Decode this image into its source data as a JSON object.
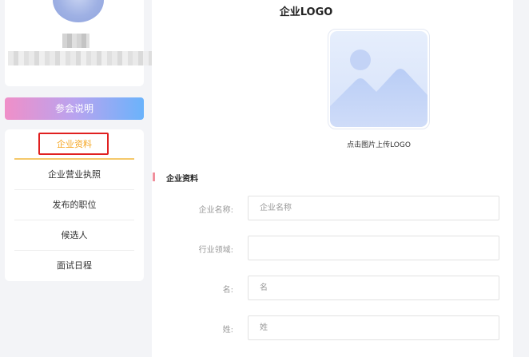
{
  "sidebar": {
    "join_button_label": "参会说明",
    "menu": [
      {
        "label": "企业资料",
        "active": true
      },
      {
        "label": "企业营业执照",
        "active": false
      },
      {
        "label": "发布的职位",
        "active": false
      },
      {
        "label": "候选人",
        "active": false
      },
      {
        "label": "面试日程",
        "active": false
      }
    ]
  },
  "main": {
    "logo_title": "企业LOGO",
    "logo_hint": "点击图片上传LOGO",
    "section_title": "企业资料",
    "fields": [
      {
        "label": "企业名称:",
        "value": "",
        "placeholder": "企业名称"
      },
      {
        "label": "行业领域:",
        "value": "",
        "placeholder": ""
      },
      {
        "label": "名:",
        "value": "",
        "placeholder": "名"
      },
      {
        "label": "姓:",
        "value": "",
        "placeholder": "姓"
      }
    ]
  },
  "colors": {
    "accent": "#f5a623",
    "highlight_border": "#e02020",
    "button_gradient_start": "#f08fc8",
    "button_gradient_end": "#6bb3fb"
  },
  "icons": [
    "image-placeholder-icon"
  ]
}
